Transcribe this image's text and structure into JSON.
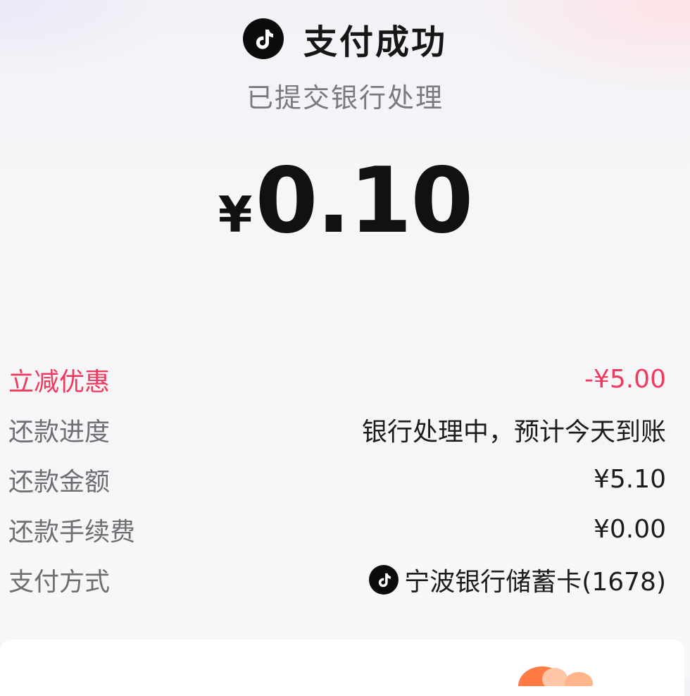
{
  "header": {
    "title": "支付成功",
    "logo_icon": "douyin-logo-icon"
  },
  "status": {
    "subtitle": "已提交银行处理"
  },
  "amount": {
    "currency": "¥",
    "value": "0.10"
  },
  "details": [
    {
      "label": "立减优惠",
      "value": "-¥5.00",
      "highlight": true
    },
    {
      "label": "还款进度",
      "value": "银行处理中，预计今天到账"
    },
    {
      "label": "还款金额",
      "value": "¥5.10"
    },
    {
      "label": "还款手续费",
      "value": "¥0.00"
    },
    {
      "label": "支付方式",
      "value": "宁波银行储蓄卡(1678)",
      "icon": "douyin-logo-icon"
    }
  ],
  "colors": {
    "accent_red": "#ef3a5d",
    "text_primary": "#161616",
    "text_secondary": "#7a7a7e"
  }
}
